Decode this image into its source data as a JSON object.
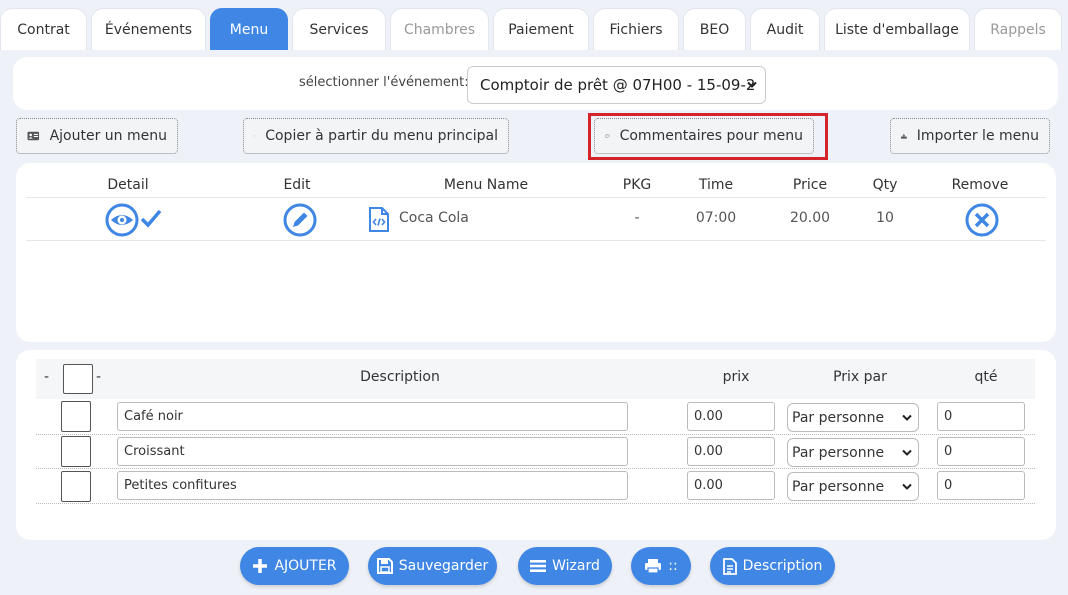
{
  "tabs": [
    {
      "label": "Contrat",
      "state": "normal"
    },
    {
      "label": "Événements",
      "state": "normal"
    },
    {
      "label": "Menu",
      "state": "active"
    },
    {
      "label": "Services",
      "state": "normal"
    },
    {
      "label": "Chambres",
      "state": "disabled"
    },
    {
      "label": "Paiement",
      "state": "normal"
    },
    {
      "label": "Fichiers",
      "state": "normal"
    },
    {
      "label": "BEO",
      "state": "normal"
    },
    {
      "label": "Audit",
      "state": "normal"
    },
    {
      "label": "Liste d'emballage",
      "state": "normal"
    },
    {
      "label": "Rappels",
      "state": "disabled"
    }
  ],
  "event_selector": {
    "label": "sélectionner l'événement:",
    "value": "Comptoir de prêt @ 07H00 - 15-09-2"
  },
  "toolbar": {
    "add_menu": "Ajouter un menu",
    "copy_main": "Copier à partir du menu principal",
    "comments": "Commentaires pour menu",
    "import_menu": "Importer le menu"
  },
  "menu_table": {
    "headers": {
      "detail": "Detail",
      "edit": "Edit",
      "name": "Menu Name",
      "pkg": "PKG",
      "time": "Time",
      "price": "Price",
      "qty": "Qty",
      "remove": "Remove"
    },
    "row": {
      "name": "Coca Cola",
      "pkg": "-",
      "time": "07:00",
      "price": "20.00",
      "qty": "10"
    }
  },
  "items_table": {
    "dash_left": "-",
    "dash_right": "-",
    "headers": {
      "description": "Description",
      "price": "prix",
      "price_per": "Prix par",
      "qty": "qté"
    },
    "rows": [
      {
        "description": "Café noir",
        "price": "0.00",
        "price_per": "Par personne",
        "qty": "0"
      },
      {
        "description": "Croissant",
        "price": "0.00",
        "price_per": "Par personne",
        "qty": "0"
      },
      {
        "description": "Petites confitures",
        "price": "0.00",
        "price_per": "Par personne",
        "qty": "0"
      }
    ]
  },
  "actions": {
    "add": "AJOUTER",
    "save": "Sauvegarder",
    "wizard": "Wizard",
    "print": "::",
    "description": "Description"
  },
  "colors": {
    "accent": "#3f86e5",
    "highlight": "#d5232b"
  },
  "icons": [
    "eye-icon",
    "check-icon",
    "pencil-icon",
    "code-file-icon",
    "remove-circle-icon",
    "id-card-icon",
    "copy-icon",
    "comment-icon",
    "download-icon",
    "plus-icon",
    "save-icon",
    "list-icon",
    "printer-icon",
    "document-icon"
  ]
}
